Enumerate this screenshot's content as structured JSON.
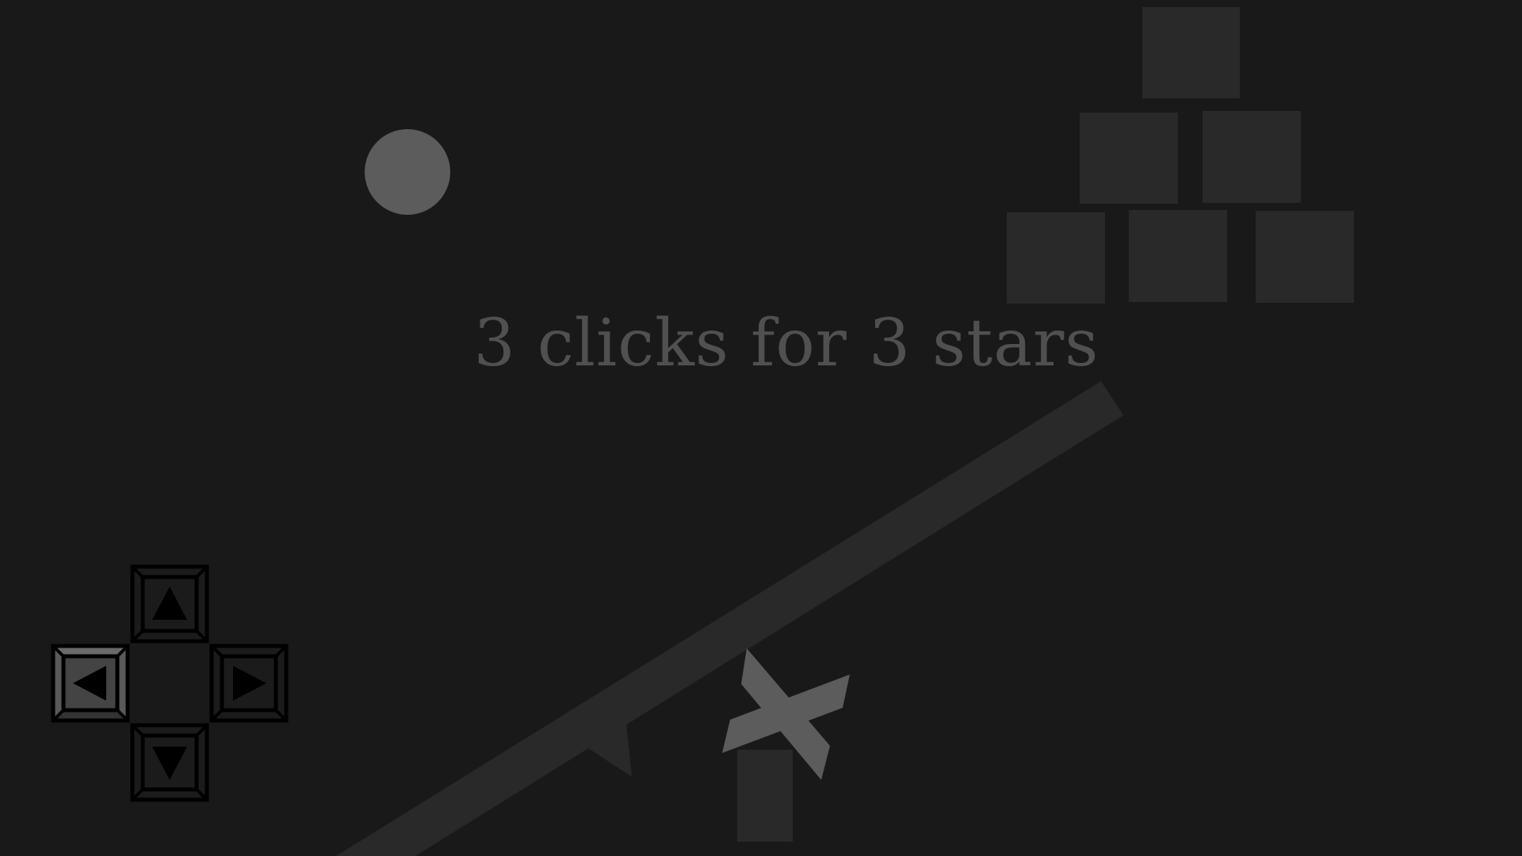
{
  "hint": {
    "text": "3 clicks for 3 stars"
  },
  "controls": {
    "up_icon": "arrow-up-icon",
    "left_icon": "arrow-left-icon",
    "right_icon": "arrow-right-icon",
    "down_icon": "arrow-down-icon"
  },
  "colors": {
    "background": "#191919",
    "blocks": "#292929",
    "ball": "#5c5c5c",
    "text": "#505050",
    "key_face": "#444444",
    "key_outline": "#000000"
  }
}
